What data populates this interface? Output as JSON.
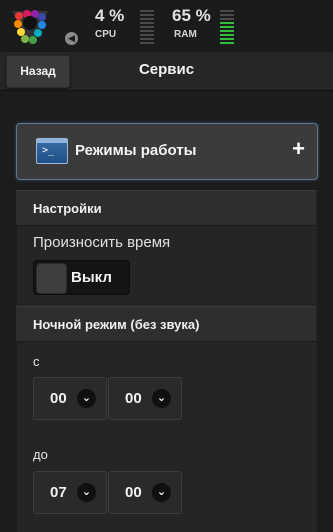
{
  "status": {
    "cpu": {
      "value": "4 %",
      "label": "CPU",
      "level": 0
    },
    "ram": {
      "value": "65 %",
      "label": "RAM",
      "level": 0.65
    },
    "collapse_glyph": "◀"
  },
  "header": {
    "back_label": "Назад",
    "title": "Сервис"
  },
  "modes": {
    "icon": "terminal-icon",
    "icon_glyph": ">_",
    "label": "Режимы работы",
    "plus_glyph": "+"
  },
  "settings": {
    "heading": "Настройки",
    "speak_time_label": "Произносить время",
    "speak_time_toggle": "Выкл"
  },
  "night_mode": {
    "heading": "Ночной режим (без звука)",
    "from_label": "с",
    "from_hour": "00",
    "from_minute": "00",
    "to_label": "до",
    "to_hour": "07",
    "to_minute": "00",
    "chevron_glyph": "⌄"
  },
  "colors": {
    "bar_on": "#2fbf3c",
    "bar_off": "#4a4a4a",
    "accent_border": "#5b7890"
  }
}
